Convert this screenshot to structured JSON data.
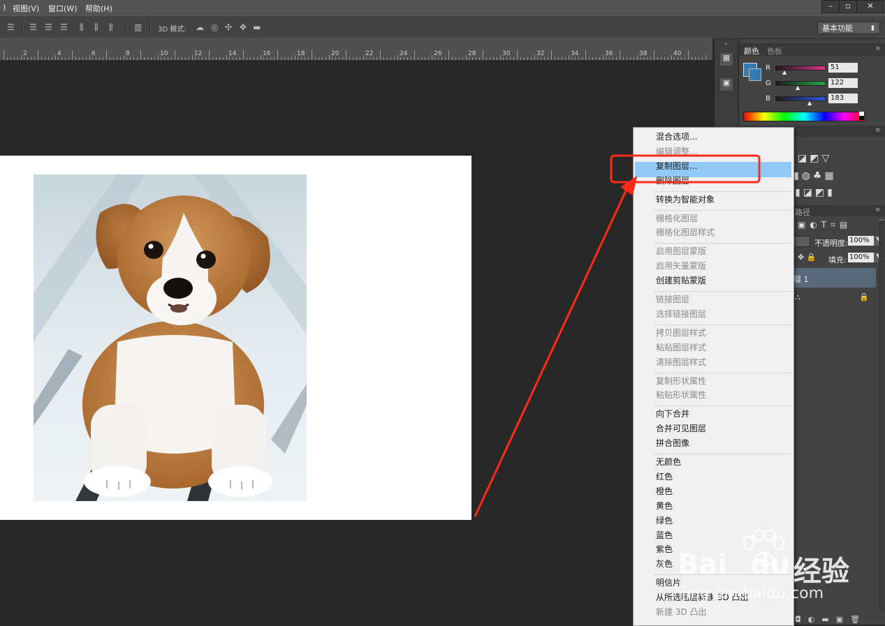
{
  "menubar": {
    "items": [
      "视图(V)",
      "窗口(W)",
      "帮助(H)"
    ],
    "window_buttons": [
      "–",
      "▫",
      "✕"
    ]
  },
  "optbar": {
    "mode_label": "3D 模式:",
    "workspace": "基本功能"
  },
  "ruler": {
    "labels": [
      "2",
      "4",
      "6",
      "8",
      "10",
      "12",
      "14",
      "16",
      "18",
      "20",
      "22",
      "24",
      "26",
      "28",
      "30",
      "32",
      "34",
      "36",
      "38",
      "40"
    ]
  },
  "color_panel": {
    "tabs": [
      "颜色",
      "色板"
    ],
    "channels": [
      {
        "label": "R",
        "value": "51",
        "color": "#dd3388"
      },
      {
        "label": "G",
        "value": "122",
        "color": "#22aa44"
      },
      {
        "label": "B",
        "value": "183",
        "color": "#3355dd"
      }
    ],
    "foreground": "#337ab7"
  },
  "layers_panel": {
    "tab_fragment": "路径",
    "opacity_label": "不透明度:",
    "opacity_value": "100%",
    "fill_label": "填充:",
    "fill_value": "100%",
    "layer_name": "层 1"
  },
  "context_menu": {
    "groups": [
      [
        {
          "label": "混合选项...",
          "enabled": true
        },
        {
          "label": "编辑调整...",
          "enabled": false
        },
        {
          "label": "复制图层...",
          "enabled": true,
          "selected": true
        },
        {
          "label": "删除图层",
          "enabled": true
        }
      ],
      [
        {
          "label": "转换为智能对象",
          "enabled": true
        }
      ],
      [
        {
          "label": "栅格化图层",
          "enabled": false
        },
        {
          "label": "栅格化图层样式",
          "enabled": false
        }
      ],
      [
        {
          "label": "启用图层蒙版",
          "enabled": false
        },
        {
          "label": "启用矢量蒙版",
          "enabled": false
        },
        {
          "label": "创建剪贴蒙版",
          "enabled": true
        }
      ],
      [
        {
          "label": "链接图层",
          "enabled": false
        },
        {
          "label": "选择链接图层",
          "enabled": false
        }
      ],
      [
        {
          "label": "拷贝图层样式",
          "enabled": false
        },
        {
          "label": "粘贴图层样式",
          "enabled": false
        },
        {
          "label": "清除图层样式",
          "enabled": false
        }
      ],
      [
        {
          "label": "复制形状属性",
          "enabled": false
        },
        {
          "label": "粘贴形状属性",
          "enabled": false
        }
      ],
      [
        {
          "label": "向下合并",
          "enabled": true
        },
        {
          "label": "合并可见图层",
          "enabled": true
        },
        {
          "label": "拼合图像",
          "enabled": true
        }
      ],
      [
        {
          "label": "无颜色",
          "enabled": true
        },
        {
          "label": "红色",
          "enabled": true
        },
        {
          "label": "橙色",
          "enabled": true
        },
        {
          "label": "黄色",
          "enabled": true
        },
        {
          "label": "绿色",
          "enabled": true
        },
        {
          "label": "蓝色",
          "enabled": true
        },
        {
          "label": "紫色",
          "enabled": true
        },
        {
          "label": "灰色",
          "enabled": true
        }
      ],
      [
        {
          "label": "明信片",
          "enabled": true
        },
        {
          "label": "从所选图层新建 3D 凸出",
          "enabled": true
        },
        {
          "label": "新建 3D 凸出",
          "enabled": false
        }
      ]
    ]
  },
  "annotation": {
    "color": "#ff2a1a"
  },
  "watermark": {
    "brand": "Bai",
    "brand2": "du",
    "suffix": "经验",
    "url": "jingyan.baidu.com"
  }
}
